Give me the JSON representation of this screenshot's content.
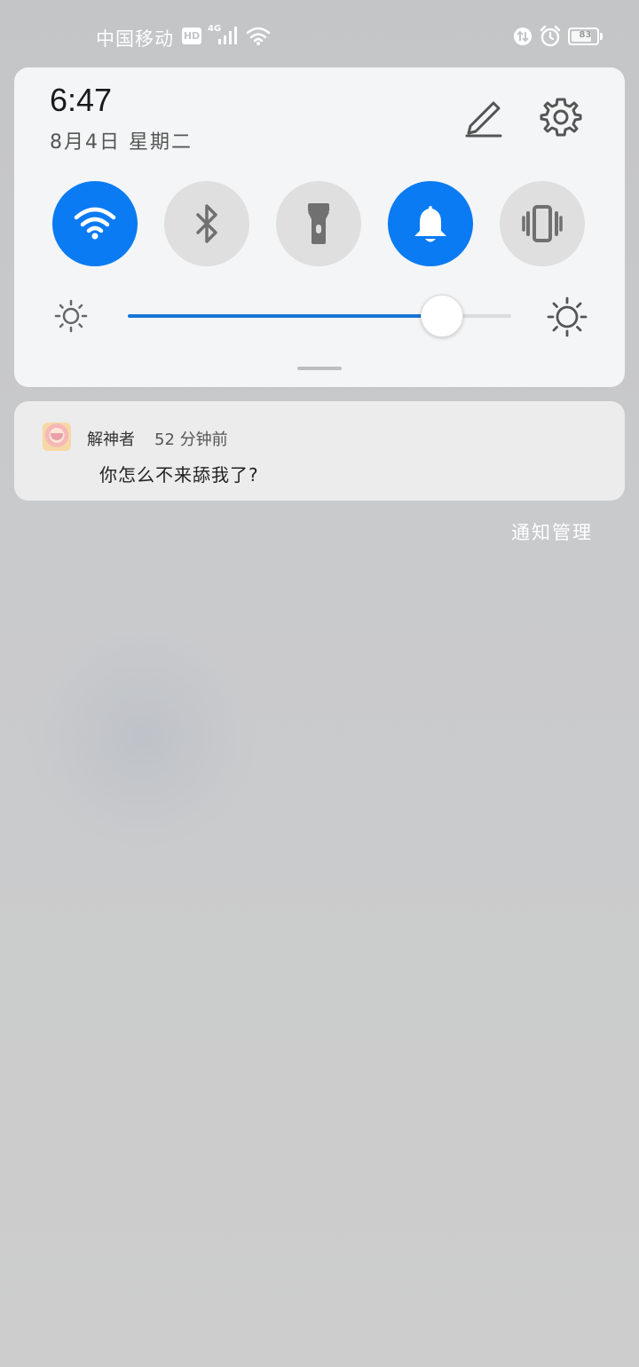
{
  "status_bar": {
    "carrier": "中国移动",
    "hd_badge": "HD",
    "network_type": "4G",
    "battery_level": "83",
    "battery_percent": 83,
    "icons": [
      "hd-icon",
      "signal-icon",
      "wifi-icon",
      "data-saver-icon",
      "alarm-icon",
      "battery-icon"
    ]
  },
  "control_panel": {
    "time": "6:47",
    "date": "8月4日 星期二",
    "toggles": [
      {
        "name": "wifi",
        "icon": "wifi-icon",
        "active": true
      },
      {
        "name": "bluetooth",
        "icon": "bluetooth-icon",
        "active": false
      },
      {
        "name": "flashlight",
        "icon": "flashlight-icon",
        "active": false
      },
      {
        "name": "sound",
        "icon": "bell-icon",
        "active": true
      },
      {
        "name": "vibrate",
        "icon": "vibrate-icon",
        "active": false
      }
    ],
    "brightness_fraction": 0.82,
    "accent_color": "#0a7bf2"
  },
  "notification": {
    "app_name": "解神者",
    "time": "52 分钟前",
    "message": "你怎么不来舔我了?"
  },
  "notification_manage": "通知管理"
}
